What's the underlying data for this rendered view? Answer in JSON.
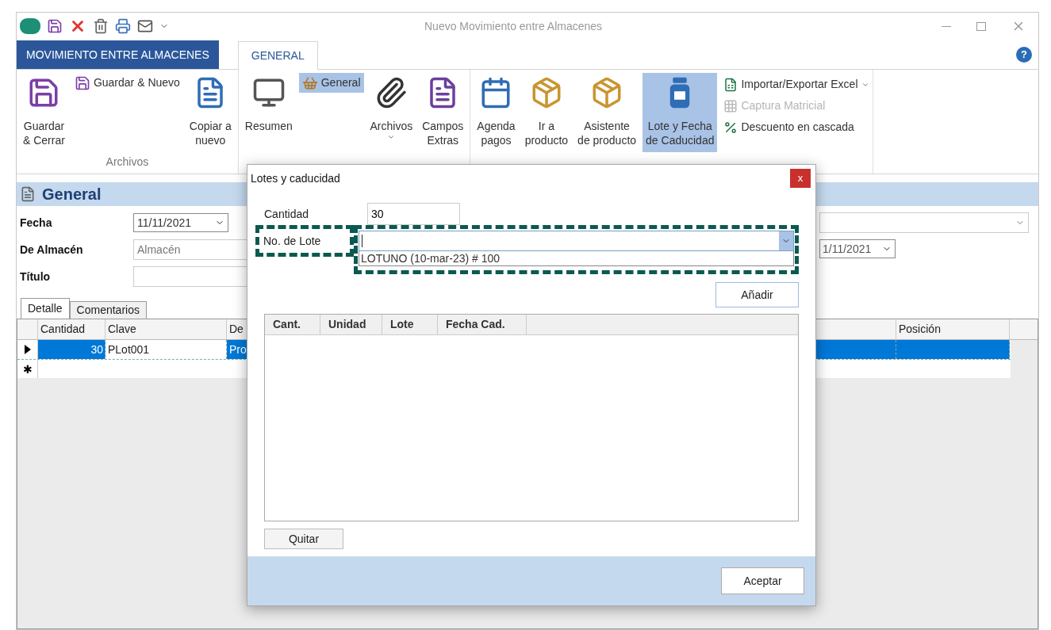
{
  "window": {
    "title": "Nuevo Movimiento entre Almacenes"
  },
  "app_tab": "MOVIMIENTO ENTRE ALMACENES",
  "tabs": [
    {
      "label": "GENERAL",
      "selected": true
    }
  ],
  "help": "?",
  "ribbon_groups": [
    {
      "label": "Archivos",
      "buttons": [
        {
          "kind": "large",
          "label": "Guardar\n& Cerrar",
          "selected": false,
          "menu": false
        },
        {
          "kind": "small",
          "label": "Guardar & Nuevo",
          "selected": false,
          "menu": false
        },
        {
          "kind": "large",
          "label": "Copiar a\nnuevo",
          "selected": false,
          "menu": false
        }
      ]
    },
    {
      "buttons": [
        {
          "kind": "large",
          "label": "Resumen",
          "selected": false,
          "menu": false
        },
        {
          "kind": "small",
          "label": "General",
          "selected": true,
          "menu": false
        },
        {
          "kind": "large",
          "label": "Archivos",
          "selected": false,
          "menu": true
        },
        {
          "kind": "large",
          "label": "Campos\nExtras",
          "selected": false,
          "menu": false
        }
      ]
    },
    {
      "buttons": [
        {
          "kind": "large",
          "label": "Agenda\npagos",
          "selected": false,
          "menu": false
        },
        {
          "kind": "large",
          "label": "Ir a\nproducto",
          "selected": false,
          "menu": false
        },
        {
          "kind": "large",
          "label": "Asistente\nde producto",
          "selected": false,
          "menu": false
        },
        {
          "kind": "large",
          "label": "Lote y Fecha\nde Caducidad",
          "selected": true,
          "menu": false
        }
      ],
      "side_list": [
        {
          "label": "Importar/Exportar Excel",
          "menu": true,
          "disabled": false
        },
        {
          "label": "Captura Matricial",
          "menu": false,
          "disabled": true
        },
        {
          "label": "Descuento en cascada",
          "menu": false,
          "disabled": false
        }
      ]
    }
  ],
  "section": {
    "title": "General"
  },
  "form": [
    {
      "label": "Fecha",
      "kind": "date",
      "value": "11/11/2021"
    },
    {
      "label": "De Almacén",
      "kind": "text",
      "placeholder": "Almacén"
    },
    {
      "label": "Título",
      "kind": "text"
    }
  ],
  "form_right": [
    {
      "kind": "combo"
    },
    {
      "kind": "date",
      "value": "1/11/2021"
    }
  ],
  "detail_tabs": [
    {
      "label": "Detalle",
      "selected": true
    },
    {
      "label": "Comentarios",
      "selected": false
    }
  ],
  "grid": {
    "columns": [
      "Cantidad",
      "Clave",
      "De",
      "Posición"
    ],
    "rows": [
      {
        "selected": true,
        "cells": [
          "30",
          "PLot001",
          "Pro",
          ""
        ]
      }
    ],
    "new_row_marker": "✱"
  },
  "dialog": {
    "title": "Lotes y caducidad",
    "close": "x",
    "quantity": {
      "label": "Cantidad",
      "value": "30"
    },
    "lot": {
      "label": "No. de Lote",
      "options": [
        "LOTUNO (10-mar-23) # 100"
      ]
    },
    "add_button": "Añadir",
    "columns": [
      "Cant.",
      "Unidad",
      "Lote",
      "Fecha Cad."
    ],
    "remove_button": "Quitar",
    "ok_button": "Aceptar"
  }
}
